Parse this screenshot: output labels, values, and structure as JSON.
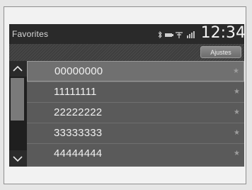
{
  "header": {
    "title": "Favorites",
    "clock": "12:34"
  },
  "toolbar": {
    "adjust_label": "Ajustes"
  },
  "favorites": [
    {
      "number": "00000000",
      "star": "★"
    },
    {
      "number": "11111111",
      "star": "★"
    },
    {
      "number": "22222222",
      "star": "★"
    },
    {
      "number": "33333333",
      "star": "★"
    },
    {
      "number": "44444444",
      "star": "★"
    }
  ],
  "colors": {
    "screen_bg": "#2f2f2f",
    "row_bg": "#5a5a5a",
    "selected_row_bg": "#707070",
    "text": "#f0f0f0"
  },
  "icons": {
    "status": [
      "bluetooth-icon",
      "signal-icon",
      "battery-icon",
      "network-icon"
    ],
    "scroll": [
      "chevron-up-icon",
      "chevron-down-icon"
    ],
    "favorite": "star-icon"
  }
}
